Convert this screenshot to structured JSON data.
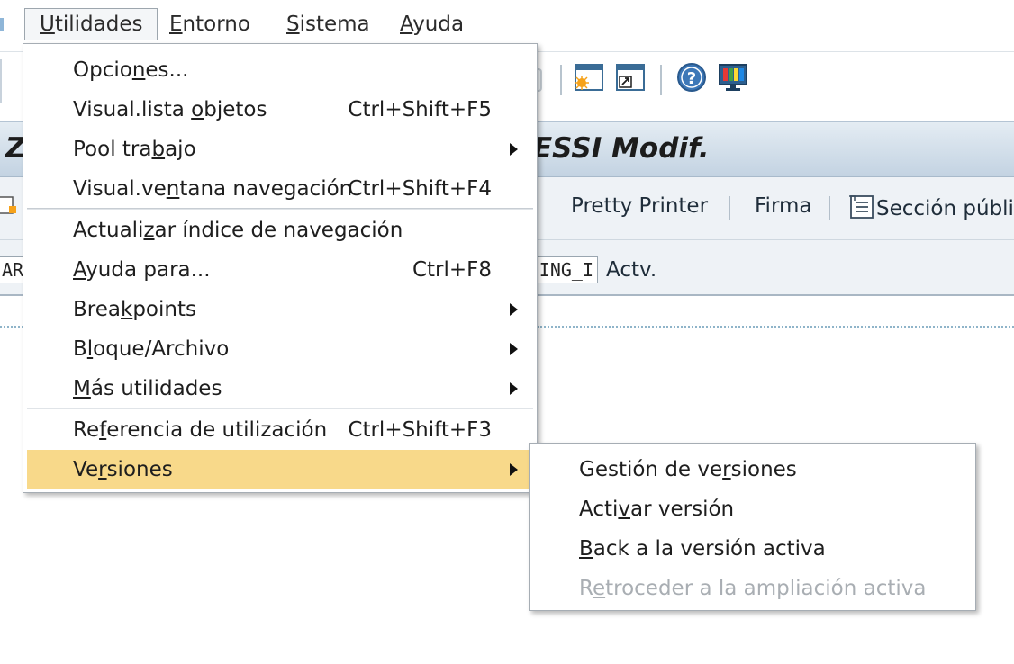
{
  "menubar": {
    "items": [
      {
        "pre": "",
        "ul": "U",
        "post": "tilidades"
      },
      {
        "pre": "",
        "ul": "E",
        "post": "ntorno"
      },
      {
        "pre": "",
        "ul": "S",
        "post": "istema"
      },
      {
        "pre": "",
        "ul": "A",
        "post": "yuda"
      }
    ]
  },
  "toolbar": {
    "icons": [
      "new-session-icon",
      "generate-shortcut-icon",
      "help-icon",
      "customize-layout-icon"
    ]
  },
  "title": {
    "left": "Z",
    "right": "ESSI Modif."
  },
  "app_toolbar": {
    "pretty_printer": "Pretty Printer",
    "firma": "Firma",
    "seccion": "Sección públic"
  },
  "fields": {
    "left_value": "AR",
    "right_value": "ING_I",
    "state": "Actv."
  },
  "utilities_menu": {
    "items": [
      {
        "pre": "Opcio",
        "ul": "n",
        "post": "es...",
        "shortcut": ""
      },
      {
        "pre": "Visual.lista ",
        "ul": "o",
        "post": "bjetos",
        "shortcut": "Ctrl+Shift+F5"
      },
      {
        "pre": "Pool tra",
        "ul": "b",
        "post": "ajo",
        "shortcut": ""
      },
      {
        "pre": "Visual.ve",
        "ul": "n",
        "post": "tana navegación",
        "shortcut": "Ctrl+Shift+F4"
      },
      {
        "pre": "Actuali",
        "ul": "z",
        "post": "ar índice de navegación",
        "shortcut": ""
      },
      {
        "pre": "",
        "ul": "A",
        "post": "yuda para...",
        "shortcut": "Ctrl+F8"
      },
      {
        "pre": "Brea",
        "ul": "k",
        "post": "points",
        "shortcut": ""
      },
      {
        "pre": "B",
        "ul": "l",
        "post": "oque/Archivo",
        "shortcut": ""
      },
      {
        "pre": "",
        "ul": "M",
        "post": "ás utilidades",
        "shortcut": ""
      },
      {
        "pre": "Re",
        "ul": "f",
        "post": "erencia de utilización",
        "shortcut": "Ctrl+Shift+F3"
      },
      {
        "pre": "Ve",
        "ul": "r",
        "post": "siones",
        "shortcut": ""
      }
    ]
  },
  "versions_submenu": {
    "items": [
      {
        "pre": "Gestión de ve",
        "ul": "r",
        "post": "siones",
        "enabled": true
      },
      {
        "pre": "Acti",
        "ul": "v",
        "post": "ar versión",
        "enabled": true
      },
      {
        "pre": "",
        "ul": "B",
        "post": "ack a la versión activa",
        "enabled": true
      },
      {
        "pre": "R",
        "ul": "e",
        "post": "troceder a la ampliación activa",
        "enabled": false
      }
    ]
  },
  "colors": {
    "highlight": "#f8d98a",
    "title_band": "#c3d3e2",
    "disabled_text": "#a9aeb3"
  }
}
